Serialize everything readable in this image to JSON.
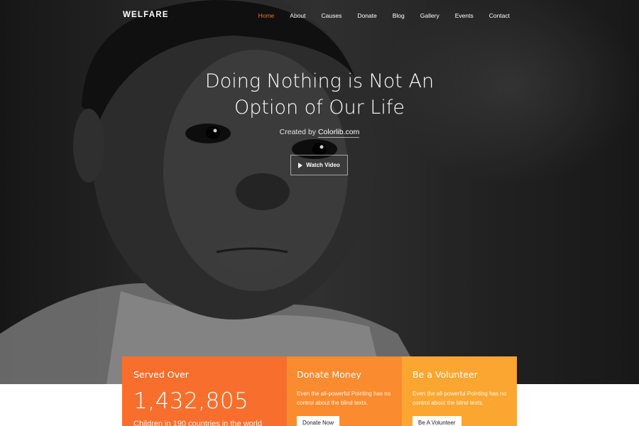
{
  "nav": {
    "logo": "WELFARE",
    "items": [
      {
        "label": "Home",
        "active": true
      },
      {
        "label": "About"
      },
      {
        "label": "Causes"
      },
      {
        "label": "Donate"
      },
      {
        "label": "Blog"
      },
      {
        "label": "Gallery"
      },
      {
        "label": "Events"
      },
      {
        "label": "Contact"
      }
    ]
  },
  "hero": {
    "title_line1": "Doing Nothing is Not An",
    "title_line2": "Option of Our Life",
    "credit_prefix": "Created by",
    "credit_link": "Colorlib.com",
    "watch_label": "Watch Video"
  },
  "cards": {
    "served": {
      "title": "Served Over",
      "count": "1,432,805",
      "subtitle": "Children in 190 countries in the world"
    },
    "donate": {
      "title": "Donate Money",
      "text": "Even the all-powerful Pointing has no control about the blind texts.",
      "button": "Donate Now"
    },
    "volunteer": {
      "title": "Be a Volunteer",
      "text": "Even the all-powerful Pointing has no control about the blind texts.",
      "button": "Be A Volunteer"
    }
  },
  "colors": {
    "accent": "#f86f2d",
    "card1": "#f86f2d",
    "card2": "#fb8b2f",
    "card3": "#fba630"
  }
}
